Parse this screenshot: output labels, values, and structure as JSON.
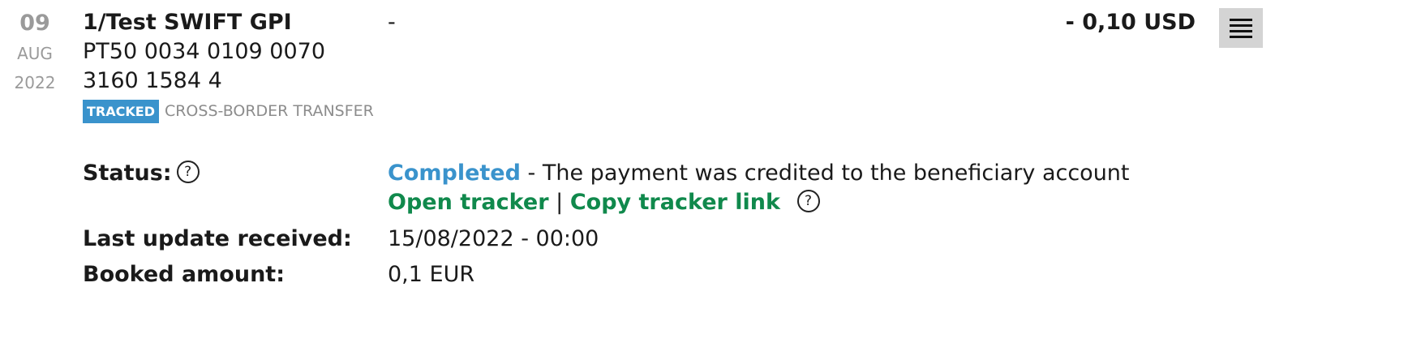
{
  "date": {
    "day": "09",
    "month": "AUG",
    "year": "2022"
  },
  "transaction": {
    "title": "1/Test SWIFT GPI",
    "iban": "PT50 0034 0109 0070 3160 1584 4",
    "badge": "TRACKED",
    "category": "CROSS-BORDER TRANSFER",
    "counterparty": "-",
    "amount": "- 0,10 USD"
  },
  "menu": {
    "icon": "hamburger-menu-icon"
  },
  "details": {
    "status_label": "Status:",
    "status_value": "Completed",
    "status_separator": " - ",
    "status_description": "The payment was credited to the beneficiary account",
    "open_tracker": "Open tracker",
    "link_separator": "|",
    "copy_tracker": "Copy tracker link",
    "help_glyph": "?",
    "last_update_label": "Last update received:",
    "last_update_value": "15/08/2022 - 00:00",
    "booked_amount_label": "Booked amount:",
    "booked_amount_value": "0,1 EUR"
  },
  "colors": {
    "accent_blue": "#3a93cc",
    "link_green": "#10894c",
    "muted_grey": "#9a9a9a"
  }
}
